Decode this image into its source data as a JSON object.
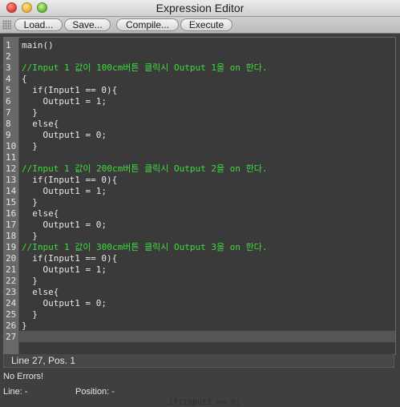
{
  "window": {
    "title": "Expression Editor"
  },
  "toolbar": {
    "load_label": "Load...",
    "save_label": "Save...",
    "compile_label": "Compile...",
    "execute_label": "Execute"
  },
  "editor": {
    "lines": [
      {
        "n": "1",
        "text": "main()",
        "type": "code"
      },
      {
        "n": "2",
        "text": "",
        "type": "code"
      },
      {
        "n": "3",
        "text": "//Input 1 값이 100cm버튼 클릭시 Output 1을 on 한다.",
        "type": "comment"
      },
      {
        "n": "4",
        "text": "{",
        "type": "code"
      },
      {
        "n": "5",
        "text": "  if(Input1 == 0){",
        "type": "code"
      },
      {
        "n": "6",
        "text": "    Output1 = 1;",
        "type": "code"
      },
      {
        "n": "7",
        "text": "  }",
        "type": "code"
      },
      {
        "n": "8",
        "text": "  else{",
        "type": "code"
      },
      {
        "n": "9",
        "text": "    Output1 = 0;",
        "type": "code"
      },
      {
        "n": "10",
        "text": "  }",
        "type": "code"
      },
      {
        "n": "11",
        "text": "",
        "type": "code"
      },
      {
        "n": "12",
        "text": "//Input 1 값이 200cm버튼 클릭시 Output 2을 on 한다.",
        "type": "comment"
      },
      {
        "n": "13",
        "text": "  if(Input1 == 0){",
        "type": "code"
      },
      {
        "n": "14",
        "text": "    Output1 = 1;",
        "type": "code"
      },
      {
        "n": "15",
        "text": "  }",
        "type": "code"
      },
      {
        "n": "16",
        "text": "  else{",
        "type": "code"
      },
      {
        "n": "17",
        "text": "    Output1 = 0;",
        "type": "code"
      },
      {
        "n": "18",
        "text": "  }",
        "type": "code"
      },
      {
        "n": "19",
        "text": "//Input 1 값이 300cm버튼 클릭시 Output 3을 on 한다.",
        "type": "comment"
      },
      {
        "n": "20",
        "text": "  if(Input1 == 0){",
        "type": "code"
      },
      {
        "n": "21",
        "text": "    Output1 = 1;",
        "type": "code"
      },
      {
        "n": "22",
        "text": "  }",
        "type": "code"
      },
      {
        "n": "23",
        "text": "  else{",
        "type": "code"
      },
      {
        "n": "24",
        "text": "    Output1 = 0;",
        "type": "code"
      },
      {
        "n": "25",
        "text": "  }",
        "type": "code"
      },
      {
        "n": "26",
        "text": "}",
        "type": "code"
      },
      {
        "n": "27",
        "text": "",
        "type": "code"
      }
    ]
  },
  "status": {
    "cursor_text": "Line 27, Pos. 1"
  },
  "output": {
    "message": "No Errors!",
    "line_label": "Line: -",
    "position_label": "Position: -",
    "background_text": "if(Input1 == 0)"
  }
}
